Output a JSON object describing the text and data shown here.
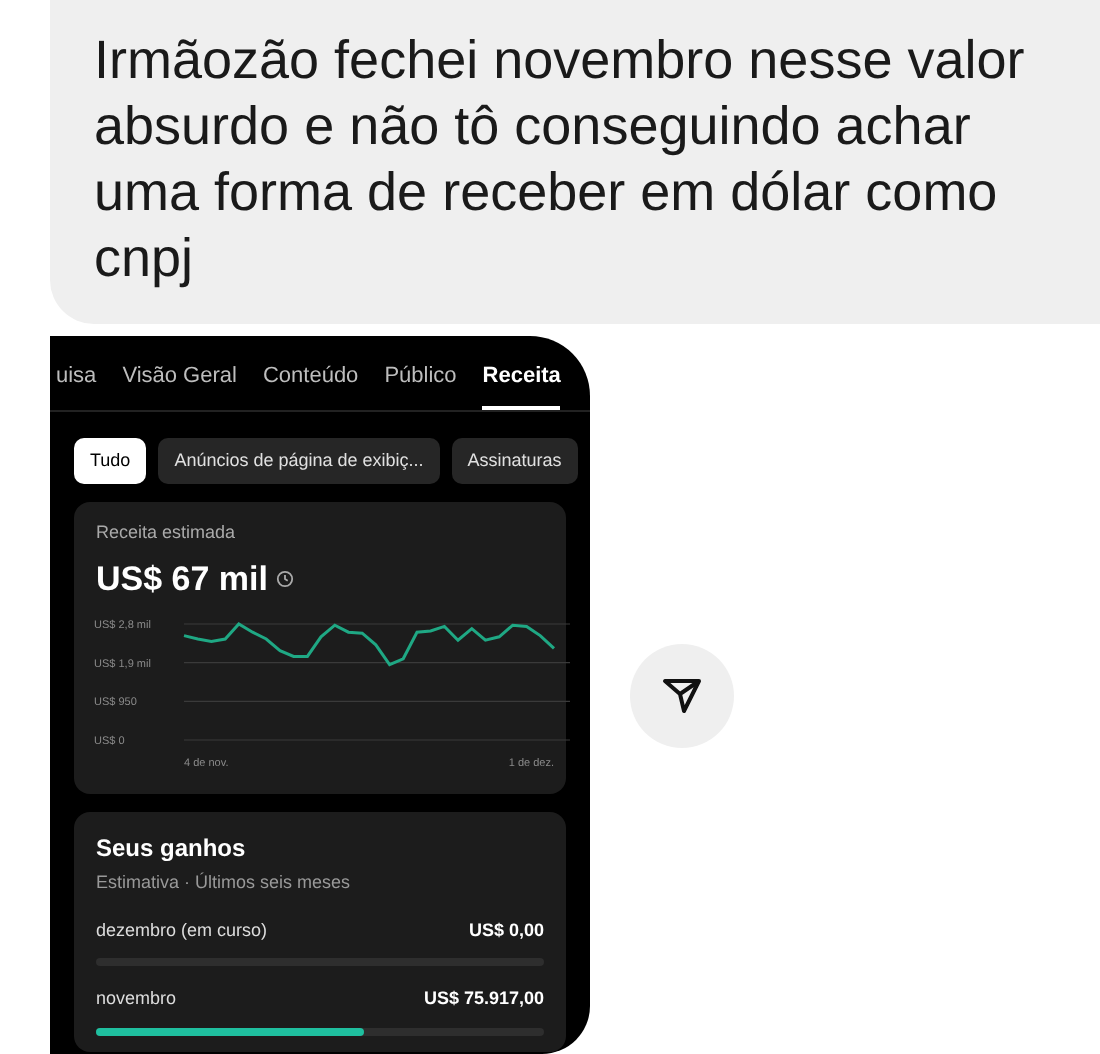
{
  "message": {
    "text": "Irmãozão fechei novembro nesse valor absurdo e não tô conseguindo achar uma forma de receber em dólar como cnpj"
  },
  "screenshot": {
    "tabs": [
      {
        "label": "uisa",
        "selected": false
      },
      {
        "label": "Visão Geral",
        "selected": false
      },
      {
        "label": "Conteúdo",
        "selected": false
      },
      {
        "label": "Público",
        "selected": false
      },
      {
        "label": "Receita",
        "selected": true
      }
    ],
    "chips": [
      {
        "label": "Tudo",
        "selected": true
      },
      {
        "label": "Anúncios de página de exibiç...",
        "selected": false
      },
      {
        "label": "Assinaturas",
        "selected": false
      }
    ],
    "revenue_card": {
      "label": "Receita estimada",
      "value": "US$ 67 mil",
      "y_axis_labels": [
        "US$ 2,8 mil",
        "US$ 1,9 mil",
        "US$ 950",
        "US$ 0"
      ],
      "x_axis_labels": [
        "4 de nov.",
        "1 de dez."
      ]
    },
    "earnings_card": {
      "title": "Seus ganhos",
      "subtitle": "Estimativa · Últimos seis meses",
      "rows": [
        {
          "month": "dezembro (em curso)",
          "amount": "US$ 0,00"
        },
        {
          "month": "novembro",
          "amount": "US$ 75.917,00",
          "level": 0.6
        }
      ]
    }
  }
}
